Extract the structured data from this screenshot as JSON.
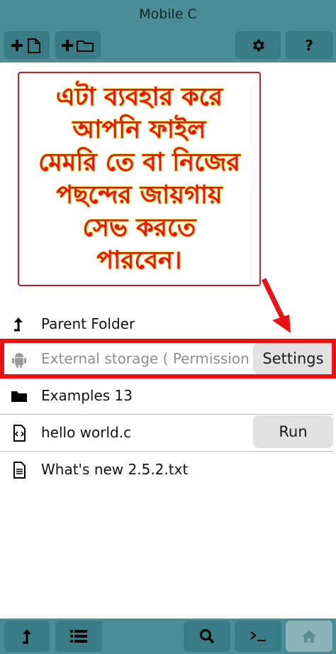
{
  "app": {
    "title": "Mobile C"
  },
  "toolbar": {
    "new_file": "new-file-icon",
    "new_folder": "new-folder-icon",
    "settings": "gear-icon",
    "help": "?"
  },
  "callout": {
    "text": "এটা ব্যবহার করে\nআপনি ফাইল\nমেমরি তে বা নিজের\nপছন্দের জায়গায়\nসেভ করতে\nপারবেন।"
  },
  "files": {
    "parent": {
      "label": "Parent Folder"
    },
    "external": {
      "label": "External storage ( Permission de",
      "button": "Settings"
    },
    "examples": {
      "label": "Examples 13"
    },
    "hello": {
      "label": "hello world.c",
      "button": "Run"
    },
    "whatsnew": {
      "label": "What's new 2.5.2.txt"
    }
  },
  "colors": {
    "bar": "#4a8d96",
    "button": "#3a7c85",
    "highlight": "#ee1111",
    "annotation_text": "#ee1111"
  }
}
